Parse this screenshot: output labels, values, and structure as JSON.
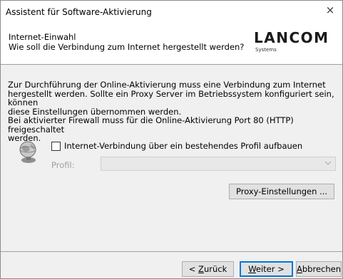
{
  "window": {
    "title": "Assistent für Software-Aktivierung",
    "close_glyph": "×"
  },
  "header": {
    "title": "Internet-Einwahl",
    "subtitle": "Wie soll die Verbindung zum Internet hergestellt werden?",
    "logo": {
      "name": "LANCOM",
      "tagline": "Systems"
    }
  },
  "main": {
    "paragraph_lines": [
      "Zur Durchführung der Online-Aktivierung muss eine Verbindung zum Internet",
      "hergestellt werden. Sollte ein Proxy Server im Betriebssystem konfiguriert sein, können",
      "diese Einstellungen übernommen werden.",
      "Bei aktivierter Firewall muss für die Online-Aktivierung Port 80 (HTTP) freigeschaltet",
      "werden."
    ],
    "profile_checkbox": {
      "label": "Internet-Verbindung über ein bestehendes Profil aufbauen",
      "checked": false
    },
    "profile_label": "Profil:",
    "profile_value": "",
    "proxy_button": "Proxy-Einstellungen ..."
  },
  "footer": {
    "back": {
      "label": "< Zurück",
      "accel": "Z"
    },
    "next": {
      "label": "Weiter >",
      "accel": "W"
    },
    "cancel": {
      "label": "Abbrechen",
      "accel": "A"
    }
  },
  "icons": {
    "globe": "globe-network-icon",
    "chevron": "chevron-down-icon",
    "close": "close-icon"
  }
}
